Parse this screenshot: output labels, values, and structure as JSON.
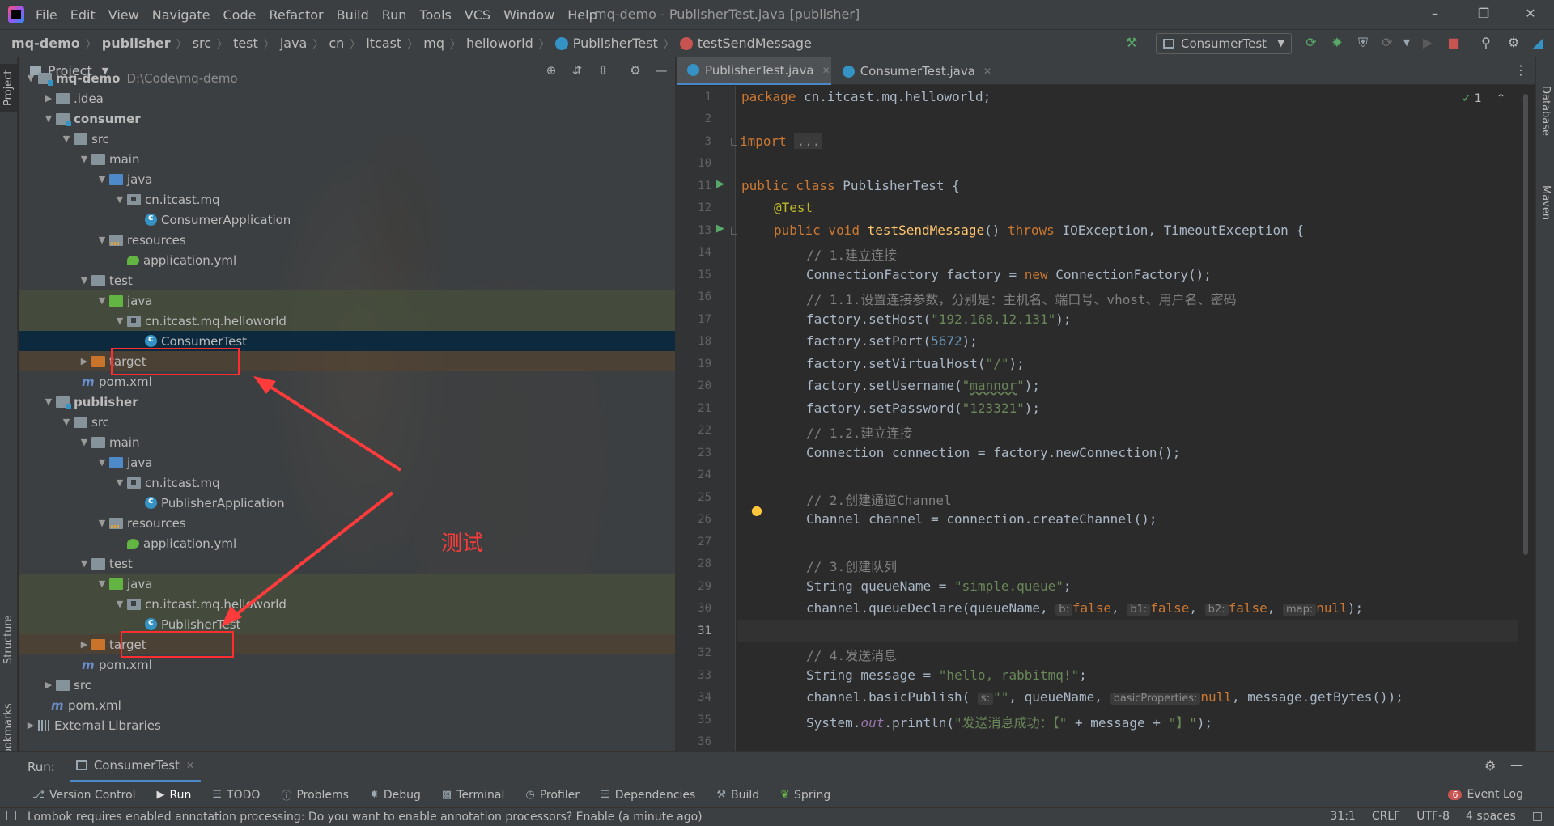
{
  "menu": {
    "items": [
      "File",
      "Edit",
      "View",
      "Navigate",
      "Code",
      "Refactor",
      "Build",
      "Run",
      "Tools",
      "VCS",
      "Window",
      "Help"
    ],
    "window_title": "mq-demo - PublisherTest.java [publisher]"
  },
  "breadcrumb": [
    "mq-demo",
    "publisher",
    "src",
    "test",
    "java",
    "cn",
    "itcast",
    "mq",
    "helloworld",
    "PublisherTest",
    "testSendMessage"
  ],
  "run_config": "ConsumerTest",
  "project_panel": {
    "title": "Project",
    "rows": [
      {
        "label": "mq-demo",
        "extra": "D:\\Code\\mq-demo"
      },
      {
        "label": ".idea"
      },
      {
        "label": "consumer"
      },
      {
        "label": "src"
      },
      {
        "label": "main"
      },
      {
        "label": "java"
      },
      {
        "label": "cn.itcast.mq"
      },
      {
        "label": "ConsumerApplication"
      },
      {
        "label": "resources"
      },
      {
        "label": "application.yml"
      },
      {
        "label": "test"
      },
      {
        "label": "java"
      },
      {
        "label": "cn.itcast.mq.helloworld"
      },
      {
        "label": "ConsumerTest"
      },
      {
        "label": "target"
      },
      {
        "label": "pom.xml"
      },
      {
        "label": "publisher"
      },
      {
        "label": "src"
      },
      {
        "label": "main"
      },
      {
        "label": "java"
      },
      {
        "label": "cn.itcast.mq"
      },
      {
        "label": "PublisherApplication"
      },
      {
        "label": "resources"
      },
      {
        "label": "application.yml"
      },
      {
        "label": "test"
      },
      {
        "label": "java"
      },
      {
        "label": "cn.itcast.mq.helloworld"
      },
      {
        "label": "PublisherTest"
      },
      {
        "label": "target"
      },
      {
        "label": "pom.xml"
      },
      {
        "label": "src"
      },
      {
        "label": "pom.xml"
      },
      {
        "label": "External Libraries"
      }
    ]
  },
  "annotation_label": "测试",
  "editor": {
    "tabs": [
      "PublisherTest.java",
      "ConsumerTest.java"
    ],
    "active_tab": "PublisherTest.java",
    "inspection_count": "1",
    "line_numbers": [
      "1",
      "2",
      "3",
      "10",
      "11",
      "12",
      "13",
      "14",
      "15",
      "16",
      "17",
      "18",
      "19",
      "20",
      "21",
      "22",
      "23",
      "24",
      "25",
      "26",
      "27",
      "28",
      "29",
      "30",
      "31",
      "32",
      "33",
      "34",
      "35",
      "36"
    ],
    "code": {
      "l1_kw": "package",
      "l1_rest": " cn.itcast.mq.helloworld;",
      "l3_kw": "import",
      "l3_fold": "...",
      "l11_kw": "public class",
      "l11_rest": " PublisherTest {",
      "l12_ann": "@Test",
      "l13_kw1": "public void",
      "l13_fn": "testSendMessage",
      "l13_mid": "() ",
      "l13_kw2": "throws",
      "l13_rest": " IOException, TimeoutException {",
      "l14_cmt": "// 1.建立连接",
      "l15_a": "ConnectionFactory factory = ",
      "l15_kw": "new",
      "l15_b": " ConnectionFactory();",
      "l16_cmt": "// 1.1.设置连接参数，分别是：主机名、端口号、vhost、用户名、密码",
      "l17_a": "factory.setHost(",
      "l17_str": "\"192.168.12.131\"",
      "l17_b": ");",
      "l18_a": "factory.setPort(",
      "l18_num": "5672",
      "l18_b": ");",
      "l19_a": "factory.setVirtualHost(",
      "l19_str": "\"/\"",
      "l19_b": ");",
      "l20_a": "factory.setUsername(",
      "l20_q1": "\"",
      "l20_str": "mannor",
      "l20_q2": "\"",
      "l20_b": ");",
      "l21_a": "factory.setPassword(",
      "l21_str": "\"123321\"",
      "l21_b": ");",
      "l22_cmt": "// 1.2.建立连接",
      "l23": "Connection connection = factory.newConnection();",
      "l25_cmt": "// 2.创建通道Channel",
      "l26": "Channel channel = connection.createChannel();",
      "l28_cmt": "// 3.创建队列",
      "l29_a": "String queueName = ",
      "l29_str": "\"simple.queue\"",
      "l29_b": ";",
      "l30_a": "channel.queueDeclare(queueName, ",
      "l30_h1": "b:",
      "l30_v1": "false",
      "l30_h2": "b1:",
      "l30_v2": "false",
      "l30_h3": "b2:",
      "l30_v3": "false",
      "l30_h4": "map:",
      "l30_v4": "null",
      "l30_b": ");",
      "l32_cmt": "// 4.发送消息",
      "l33_a": "String message = ",
      "l33_str": "\"hello, rabbitmq!\"",
      "l33_b": ";",
      "l34_a": "channel.basicPublish( ",
      "l34_h1": "s:",
      "l34_str": "\"\"",
      "l34_mid": ", queueName, ",
      "l34_h2": "basicProperties:",
      "l34_v2": "null",
      "l34_b": ", message.getBytes());",
      "l35_a": "System.",
      "l35_out": "out",
      "l35_b": ".println(",
      "l35_str1": "\"发送消息成功：【\"",
      "l35_c": " + message + ",
      "l35_str2": "\"】\"",
      "l35_d": ");"
    }
  },
  "right_strip": [
    "Database",
    "Maven"
  ],
  "left_strip": [
    "Project",
    "Structure",
    "Bookmarks"
  ],
  "run_panel": {
    "label": "Run:",
    "tab": "ConsumerTest"
  },
  "tool_windows": [
    "Version Control",
    "Run",
    "TODO",
    "Problems",
    "Debug",
    "Terminal",
    "Profiler",
    "Dependencies",
    "Build",
    "Spring"
  ],
  "event_log": {
    "count": "6",
    "label": "Event Log"
  },
  "status": {
    "message": "Lombok requires enabled annotation processing: Do you want to enable annotation processors? Enable (a minute ago)",
    "position": "31:1",
    "line_sep": "CRLF",
    "encoding": "UTF-8",
    "indent": "4 spaces"
  },
  "colors": {
    "accent": "#4a88c7",
    "annotation": "#ff2d2d",
    "selection": "#0d293e"
  }
}
